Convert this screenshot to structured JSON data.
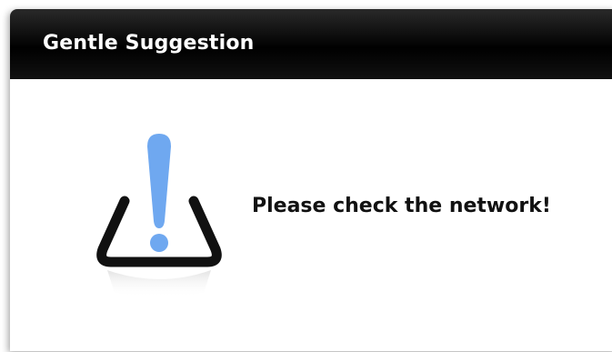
{
  "dialog": {
    "title": "Gentle Suggestion",
    "message": "Please check the network!",
    "icon": "warning-exclamation-icon",
    "colors": {
      "titlebar": "#000000",
      "title_text": "#ffffff",
      "icon_mark": "#6fa8f0",
      "icon_outline": "#111111",
      "message_text": "#111111"
    }
  }
}
